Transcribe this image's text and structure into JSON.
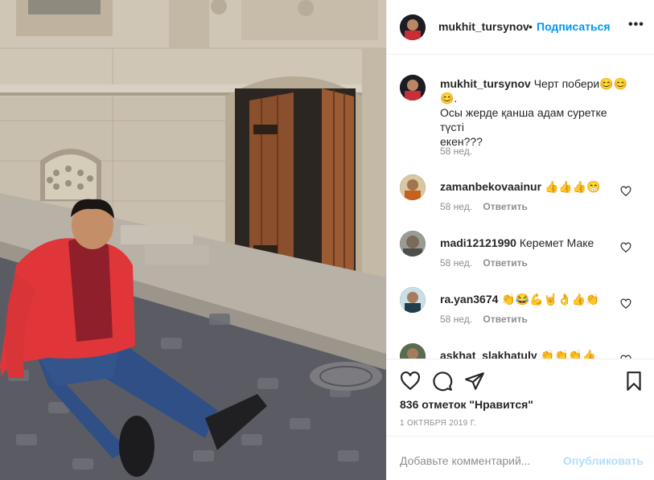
{
  "post": {
    "author": "mukhit_tursynov",
    "dot": "•",
    "follow_label": "Подписаться",
    "more_label": "•••",
    "caption_line1": "Черт побери😊😊",
    "caption_line2": "😊.",
    "caption_line3": "Осы жерде қанша адам суретке түсті",
    "caption_line4": "екен???",
    "caption_time": "58 нед.",
    "likes_text": "836 отметок \"Нравится\"",
    "date": "1 ОКТЯБРЯ 2019 Г."
  },
  "comments": [
    {
      "user": "zamanbekovaainur",
      "text": "👍👍👍😁",
      "time": "58 нед.",
      "reply": "Ответить"
    },
    {
      "user": "madi12121990",
      "text": "Керемет Маке",
      "time": "58 нед.",
      "reply": "Ответить"
    },
    {
      "user": "ra.yan3674",
      "text": "👏😂💪🤘👌👍👏",
      "time": "58 нед.",
      "reply": "Ответить"
    },
    {
      "user": "askhat_slakhatuly",
      "text": "👏👏👏👍",
      "time": "",
      "reply": ""
    }
  ],
  "add_comment": {
    "placeholder": "Добавьте комментарий...",
    "post_label": "Опубликовать"
  },
  "colors": {
    "accent": "#0095f6",
    "post_disabled": "#b2dffc",
    "muted": "#8e8e8e",
    "jacket": "#e0363a"
  }
}
